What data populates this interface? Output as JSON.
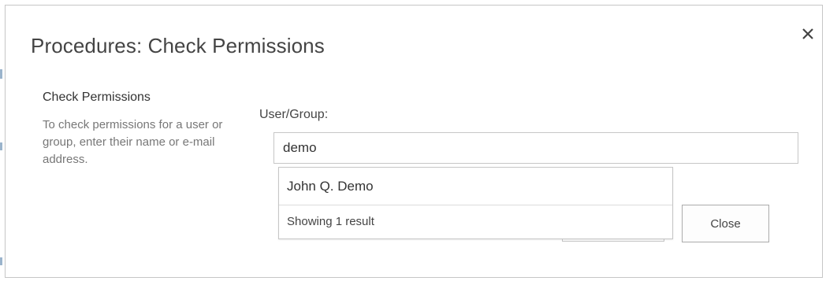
{
  "dialog": {
    "title": "Procedures: Check Permissions",
    "close_icon": "close-icon"
  },
  "section": {
    "heading": "Check Permissions",
    "description": "To check permissions for a user or group, enter their name or e-mail address."
  },
  "form": {
    "user_group_label": "User/Group:",
    "user_group_value": "demo"
  },
  "suggestions": {
    "items": [
      "John Q. Demo"
    ],
    "result_count": "Showing 1 result"
  },
  "buttons": {
    "close_label": "Close"
  },
  "colors": {
    "title_text": "#444444",
    "border": "#c6c6c6",
    "description_text": "#777777"
  }
}
